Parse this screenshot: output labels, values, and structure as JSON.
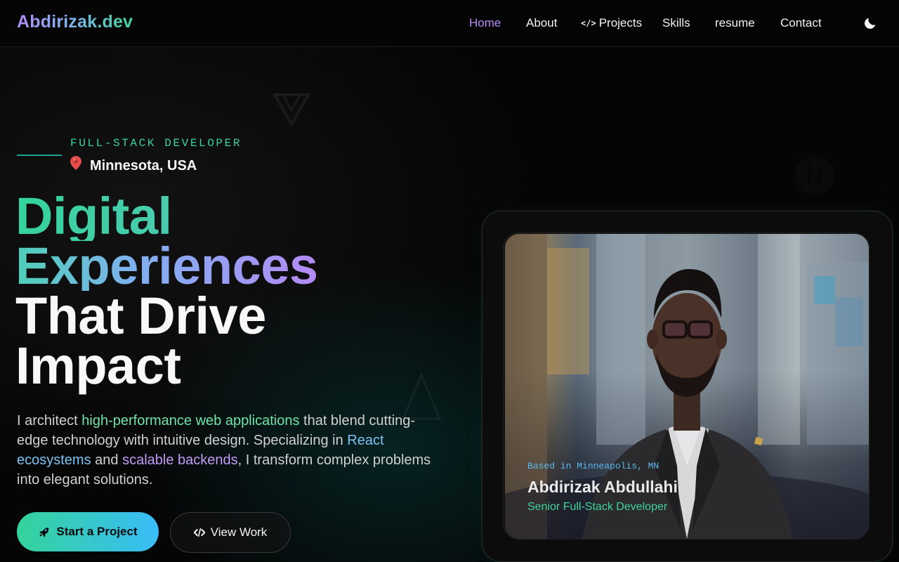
{
  "nav": {
    "logo": "Abdirizak.dev",
    "links": [
      {
        "label": "Home"
      },
      {
        "label": "About"
      },
      {
        "label": "Projects"
      },
      {
        "label": "Skills"
      },
      {
        "label": "resume"
      },
      {
        "label": "Contact"
      }
    ],
    "theme_icon": "moon-icon",
    "projects_icon": "code-icon"
  },
  "hero": {
    "eyebrow": "FULL-STACK DEVELOPER",
    "location": "Minnesota, USA",
    "location_icon": "pin-icon",
    "headline": [
      "Digital",
      "Experiences",
      "That Drive",
      "Impact"
    ],
    "lead": {
      "p1": "I architect ",
      "h1": "high-performance web applications",
      "p2": " that blend cutting-edge technology with intuitive design. Specializing in ",
      "h2": "React ecosystems",
      "p3": " and ",
      "h3": "scalable backends",
      "p4": ", I transform complex problems into elegant solutions."
    },
    "primary_button": "Start a Project",
    "primary_icon": "rocket-icon",
    "secondary_button": "View Work",
    "secondary_icon": "code-icon"
  },
  "profile_card": {
    "location": "Based in Minneapolis, MN",
    "name": "Abdirizak Abdullahi",
    "role": "Senior Full-Stack Developer"
  },
  "colors": {
    "accent_green": "#34d39b",
    "accent_blue": "#38bdf8",
    "accent_purple": "#b48af5",
    "background": "#050505"
  }
}
